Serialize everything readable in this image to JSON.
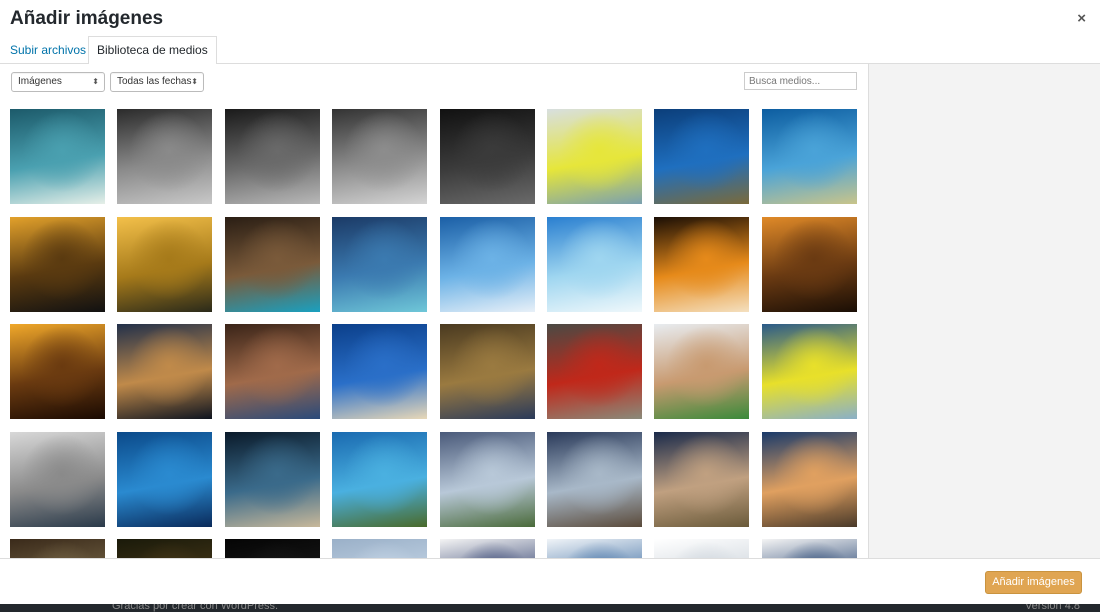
{
  "modal": {
    "title": "Añadir imágenes",
    "close_symbol": "×"
  },
  "tabs": [
    {
      "label": "Subir archivos",
      "active": false
    },
    {
      "label": "Biblioteca de medios",
      "active": true
    }
  ],
  "filters": {
    "type_selected": "Imágenes",
    "date_selected": "Todas las fechas",
    "arrow": "⬍"
  },
  "search": {
    "placeholder": "Busca medios..."
  },
  "thumbnails": [
    {
      "name": "kitesurf-wave",
      "colors": [
        "#1c5a6a",
        "#4aa0b0",
        "#e6efe8"
      ]
    },
    {
      "name": "diver-bw",
      "colors": [
        "#2b2b2b",
        "#8a8a8a",
        "#c8c8c8"
      ]
    },
    {
      "name": "diver-helmet-bw",
      "colors": [
        "#1a1a1a",
        "#6a6a6a",
        "#b8b8b8"
      ]
    },
    {
      "name": "diver-descent-bw",
      "colors": [
        "#333",
        "#8d8d8d",
        "#d4d4d4"
      ]
    },
    {
      "name": "reef-dark-bw",
      "colors": [
        "#111",
        "#3b3b3b",
        "#6a6a6a"
      ]
    },
    {
      "name": "man-yellow-shirt",
      "colors": [
        "#d8dfe0",
        "#e6e63a",
        "#7aa0b0"
      ]
    },
    {
      "name": "diver-blue",
      "colors": [
        "#0b3e7a",
        "#1f6fbf",
        "#7a6a3a"
      ]
    },
    {
      "name": "diver-sandy",
      "colors": [
        "#0d5da0",
        "#4aa3d8",
        "#c9c48a"
      ]
    },
    {
      "name": "sunset-portrait",
      "colors": [
        "#e2a12b",
        "#5a3a10",
        "#111"
      ]
    },
    {
      "name": "kite-sunset",
      "colors": [
        "#f3c04a",
        "#a67a1a",
        "#2a2a1a"
      ]
    },
    {
      "name": "kite-beach-mountain",
      "colors": [
        "#2a1e14",
        "#7a5a3a",
        "#1aa0c0"
      ]
    },
    {
      "name": "kite-blue-sky",
      "colors": [
        "#1b3a66",
        "#3b7ab0",
        "#6fc7d8"
      ]
    },
    {
      "name": "kitesurfer-air",
      "colors": [
        "#1b5fa6",
        "#6cb2e6",
        "#e8f0f8"
      ]
    },
    {
      "name": "kitesurfer-bright",
      "colors": [
        "#2a7fd0",
        "#9fd6f0",
        "#f0f8fb"
      ]
    },
    {
      "name": "woman-dancing",
      "colors": [
        "#1a0e05",
        "#e68a1a",
        "#f4e0c0"
      ]
    },
    {
      "name": "woman-poncho",
      "colors": [
        "#e08a28",
        "#6a3a12",
        "#1a0e05"
      ]
    },
    {
      "name": "woman-golden",
      "colors": [
        "#f0a82a",
        "#6a3a10",
        "#1a0a02"
      ]
    },
    {
      "name": "woman-lake-dusk",
      "colors": [
        "#22304a",
        "#c08a4a",
        "#0e1420"
      ]
    },
    {
      "name": "woman-closeup",
      "colors": [
        "#3a2418",
        "#a06a4a",
        "#2a4a7a"
      ]
    },
    {
      "name": "paraglider-blue",
      "colors": [
        "#0b3f8a",
        "#2a6fc8",
        "#e8d8b8"
      ]
    },
    {
      "name": "paraglider-hill",
      "colors": [
        "#4a3a20",
        "#9a7a40",
        "#2a3a5a"
      ]
    },
    {
      "name": "red-helmet",
      "colors": [
        "#4a4a44",
        "#c0281a",
        "#8a8a7a"
      ]
    },
    {
      "name": "athlete-stretch",
      "colors": [
        "#e8ecf0",
        "#c89a70",
        "#3a8a3a"
      ]
    },
    {
      "name": "swimmer-helmet",
      "colors": [
        "#2a5a8a",
        "#e8e02a",
        "#8ab0c8"
      ]
    },
    {
      "name": "jeep-beach",
      "colors": [
        "#d8d8d8",
        "#8a8a8a",
        "#2a3a4a"
      ]
    },
    {
      "name": "underwater-wreck",
      "colors": [
        "#0b4a8a",
        "#2a8ad0",
        "#0a2a5a"
      ]
    },
    {
      "name": "diver-stones",
      "colors": [
        "#0a1a2a",
        "#3a6a8a",
        "#c8b89a"
      ]
    },
    {
      "name": "seagrass",
      "colors": [
        "#1a6ab0",
        "#4ab0e0",
        "#4a6a2a"
      ]
    },
    {
      "name": "man-cloudy-sky",
      "colors": [
        "#4a5a7a",
        "#b8c8d8",
        "#4a6a3a"
      ]
    },
    {
      "name": "man-mountains",
      "colors": [
        "#2a3a5a",
        "#a8b8c8",
        "#5a4a3a"
      ]
    },
    {
      "name": "women-lying",
      "colors": [
        "#1a2a4a",
        "#c0a080",
        "#6a5a3a"
      ]
    },
    {
      "name": "couple-beach",
      "colors": [
        "#1a3a6a",
        "#e0a060",
        "#4a3a2a"
      ]
    },
    {
      "name": "rocks-partial",
      "colors": [
        "#3a2a1a",
        "#7a6a4a",
        "#5a4a3a"
      ]
    },
    {
      "name": "dark-forest-partial",
      "colors": [
        "#1a1a0a",
        "#4a3a1a",
        "#2a2a1a"
      ]
    },
    {
      "name": "black-partial",
      "colors": [
        "#050505",
        "#1a1a1a",
        "#0a0a0a"
      ]
    },
    {
      "name": "sky-partial",
      "colors": [
        "#9ab0c8",
        "#c8d8e8",
        "#8aa0b8"
      ]
    },
    {
      "name": "text-graphic-partial",
      "colors": [
        "#f4f4f4",
        "#2a3a6a",
        "#f4f4f4"
      ]
    },
    {
      "name": "website-partial",
      "colors": [
        "#f0f4f8",
        "#3a6aa0",
        "#e0e8f0"
      ]
    },
    {
      "name": "screenshot-partial",
      "colors": [
        "#ffffff",
        "#c8d0d8",
        "#e8ecf0"
      ]
    },
    {
      "name": "logo-partial",
      "colors": [
        "#f4f4f4",
        "#1a3a6a",
        "#f4f4f4"
      ]
    }
  ],
  "actions": {
    "insert_label": "Añadir imágenes"
  },
  "backdrop": {
    "footer_left": "Gracias por crear con WordPress.",
    "footer_right": "Versión 4.8"
  },
  "colors": {
    "link": "#0073aa",
    "primary_button": "#e0a552"
  }
}
